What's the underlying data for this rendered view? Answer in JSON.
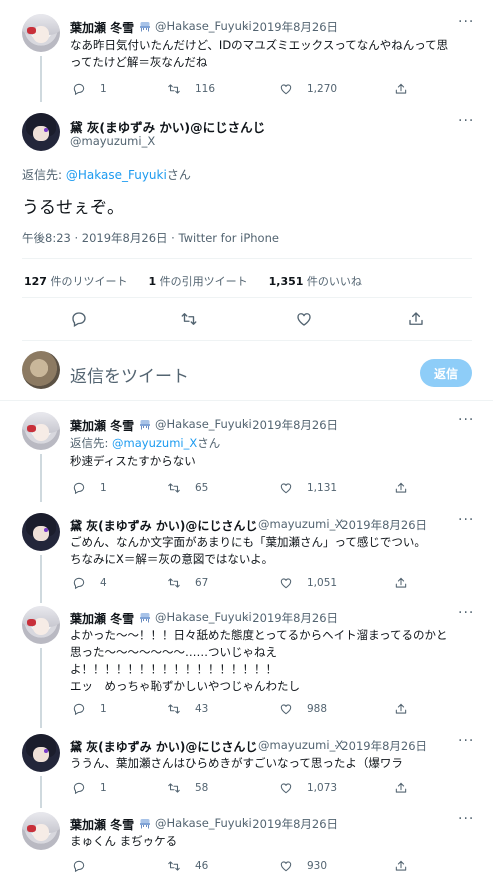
{
  "tweet0": {
    "name": "葉加瀬 冬雪",
    "handle": "@Hakase_Fuyuki",
    "date": "· 2019年8月26日",
    "line1": "なあ昨日気付いたんだけど、IDのマユズミエックスってなんやねんって思",
    "line2": "ってたけど解＝灰なんだね",
    "replies": "1",
    "retweets": "116",
    "likes": "1,270"
  },
  "main": {
    "name": "黛 灰(まゆずみ かい)@にじさんじ",
    "handle": "@mayuzumi_X",
    "reply_prefix": "返信先: ",
    "reply_link": "@Hakase_Fuyuki",
    "reply_suffix": "さん",
    "text": "うるせぇぞ。",
    "meta": "午後8:23 · 2019年8月26日 · Twitter for iPhone",
    "stats": {
      "retweets_num": "127",
      "retweets_label": "件のリツイート",
      "quotes_num": "1",
      "quotes_label": "件の引用ツイート",
      "likes_num": "1,351",
      "likes_label": "件のいいね"
    }
  },
  "composer": {
    "placeholder": "返信をツイート",
    "button": "返信"
  },
  "replies": [
    {
      "name": "葉加瀬 冬雪",
      "handle": "@Hakase_Fuyuki",
      "date": "· 2019年8月26日",
      "reply_prefix": "返信先: ",
      "reply_link": "@mayuzumi_X",
      "reply_suffix": "さん",
      "lines": [
        "秒速ディスたすからない"
      ],
      "replies": "1",
      "retweets": "65",
      "likes": "1,131"
    },
    {
      "name": "黛 灰(まゆずみ かい)@にじさんじ",
      "handle": "@mayuzumi_X",
      "date": "· 2019年8月26日",
      "lines": [
        "ごめん、なんか文字面があまりにも「葉加瀬さん」って感じでつい。",
        "ちなみにX＝解＝灰の意図ではないよ。"
      ],
      "replies": "4",
      "retweets": "67",
      "likes": "1,051"
    },
    {
      "name": "葉加瀬 冬雪",
      "handle": "@Hakase_Fuyuki",
      "date": "· 2019年8月26日",
      "lines": [
        "よかった〜〜！！！日々舐めた態度とってるからヘイト溜まってるのかと",
        "思った〜〜〜〜〜〜〜……ついじゃねえ",
        "よ！！！！！！！！！！！！！！！！！",
        "エッ　めっちゃ恥ずかしいやつじゃんわたし"
      ],
      "replies": "1",
      "retweets": "43",
      "likes": "988"
    },
    {
      "name": "黛 灰(まゆずみ かい)@にじさんじ",
      "handle": "@mayuzumi_X",
      "date": "· 2019年8月26日",
      "lines": [
        "ううん、葉加瀬さんはひらめきがすごいなって思ったよ（爆ワラ"
      ],
      "replies": "1",
      "retweets": "58",
      "likes": "1,073"
    },
    {
      "name": "葉加瀬 冬雪",
      "handle": "@Hakase_Fuyuki",
      "date": "· 2019年8月26日",
      "lines": [
        "まゅくん まぢゥケる"
      ],
      "replies": "",
      "retweets": "46",
      "likes": "930"
    }
  ],
  "more_label": "···",
  "colors": {
    "accent": "#1d9bf0",
    "button_disabled": "#8ecdf8",
    "muted": "#536471",
    "divider": "#eff3f4"
  }
}
